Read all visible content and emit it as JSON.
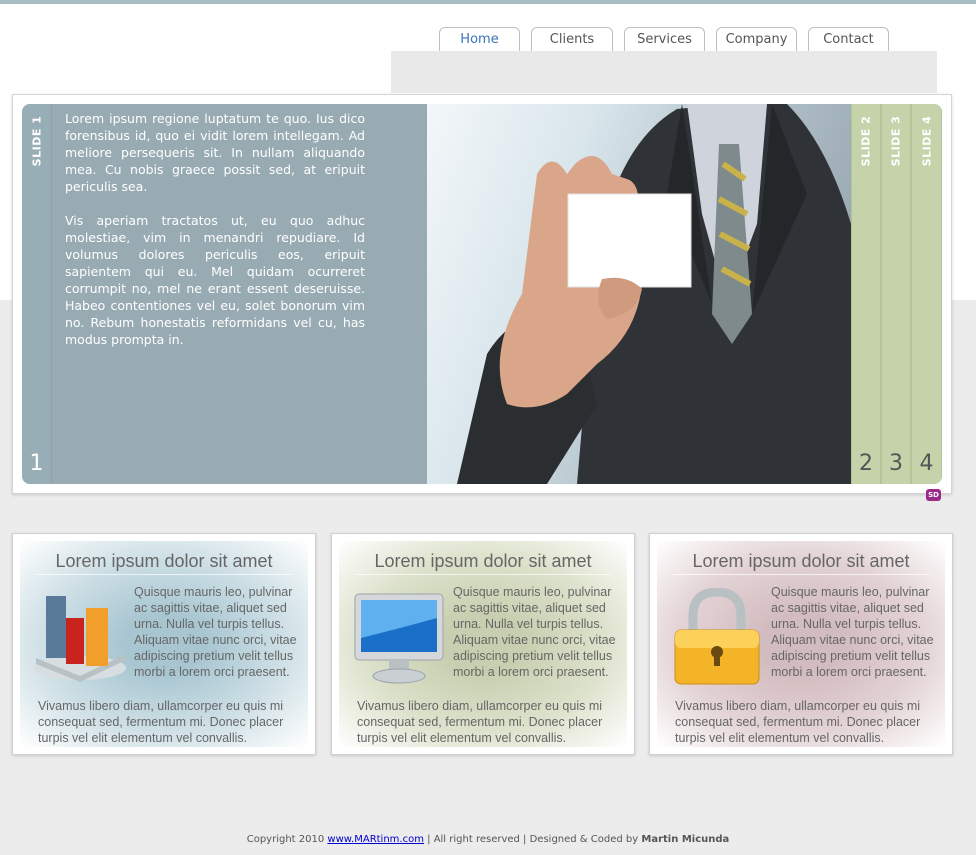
{
  "nav": {
    "tabs": [
      {
        "label": "Home",
        "active": true
      },
      {
        "label": "Clients"
      },
      {
        "label": "Services"
      },
      {
        "label": "Company"
      },
      {
        "label": "Contact"
      }
    ]
  },
  "slider": {
    "tabs": [
      {
        "label": "SLIDE 1",
        "number": "1"
      },
      {
        "label": "SLIDE 2",
        "number": "2"
      },
      {
        "label": "SLIDE 3",
        "number": "3"
      },
      {
        "label": "SLIDE 4",
        "number": "4"
      }
    ],
    "paragraphs": [
      "Lorem ipsum regione luptatum te quo. Ius dico forensibus id, quo ei vidit lorem intellegam. Ad meliore persequeris sit. In nullam aliquando mea. Cu nobis graece possit sed, at eripuit periculis sea.",
      "Vis aperiam tractatos ut, eu quo adhuc molestiae, vim in menandri repudiare. Id volumus dolores periculis eos, eripuit sapientem qui eu. Mel quidam ocurreret corrumpit no, mel ne erant essent deseruisse. Habeo contentiones vel eu, solet bonorum vim no. Rebum honestatis reformidans vel cu, has modus prompta in."
    ],
    "corner_logo": "SD"
  },
  "boxes": [
    {
      "title": "Lorem ipsum dolor sit amet",
      "text1": "Quisque mauris leo, pulvinar ac sagittis vitae, aliquet sed urna. Nulla vel turpis tellus. Aliquam vitae nunc orci, vitae adipiscing pretium velit tellus morbi a lorem orci praesent.",
      "text2": "Vivamus libero diam, ullamcorper eu quis mi consequat sed, fermentum mi. Donec placer turpis vel elit elementum vel convallis.",
      "icon": "bar-chart-icon",
      "glow": "#a8c6d1"
    },
    {
      "title": "Lorem ipsum dolor sit amet",
      "text1": "Quisque mauris leo, pulvinar ac sagittis vitae, aliquet sed urna. Nulla vel turpis tellus. Aliquam vitae nunc orci, vitae adipiscing pretium velit tellus morbi a lorem orci praesent.",
      "text2": "Vivamus libero diam, ullamcorper eu quis mi consequat sed, fermentum mi. Donec placer turpis vel elit elementum vel convallis.",
      "icon": "monitor-icon",
      "glow": "#c8cfb0"
    },
    {
      "title": "Lorem ipsum dolor sit amet",
      "text1": "Quisque mauris leo, pulvinar ac sagittis vitae, aliquet sed urna. Nulla vel turpis tellus. Aliquam vitae nunc orci, vitae adipiscing pretium velit tellus morbi a lorem orci praesent.",
      "text2": "Vivamus libero diam, ullamcorper eu quis mi consequat sed, fermentum mi. Donec placer turpis vel elit elementum vel convallis.",
      "icon": "padlock-icon",
      "glow": "#d3bcbf"
    }
  ],
  "footer": {
    "prefix": "Copyright 2010",
    "link": "www.MARtinm.com",
    "middle": "| All right reserved | Designed & Coded by",
    "author": "Martin Micunda"
  }
}
